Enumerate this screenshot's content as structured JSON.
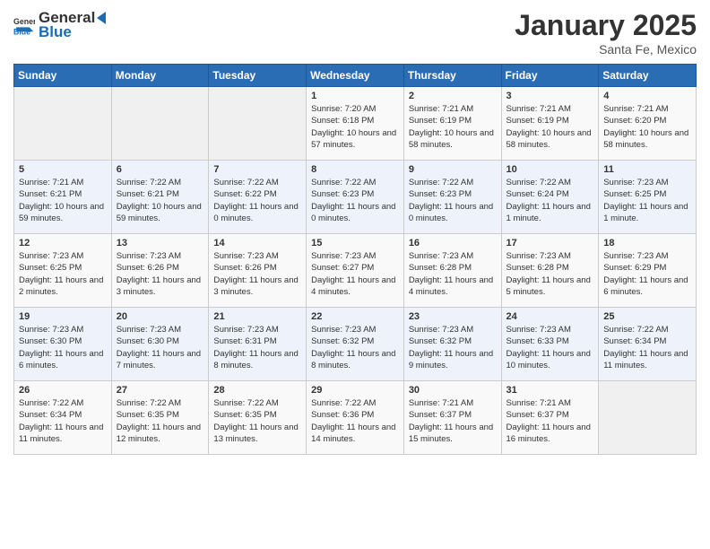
{
  "logo": {
    "general": "General",
    "blue": "Blue"
  },
  "header": {
    "month": "January 2025",
    "location": "Santa Fe, Mexico"
  },
  "weekdays": [
    "Sunday",
    "Monday",
    "Tuesday",
    "Wednesday",
    "Thursday",
    "Friday",
    "Saturday"
  ],
  "weeks": [
    [
      {
        "day": "",
        "sunrise": "",
        "sunset": "",
        "daylight": ""
      },
      {
        "day": "",
        "sunrise": "",
        "sunset": "",
        "daylight": ""
      },
      {
        "day": "",
        "sunrise": "",
        "sunset": "",
        "daylight": ""
      },
      {
        "day": "1",
        "sunrise": "Sunrise: 7:20 AM",
        "sunset": "Sunset: 6:18 PM",
        "daylight": "Daylight: 10 hours and 57 minutes."
      },
      {
        "day": "2",
        "sunrise": "Sunrise: 7:21 AM",
        "sunset": "Sunset: 6:19 PM",
        "daylight": "Daylight: 10 hours and 58 minutes."
      },
      {
        "day": "3",
        "sunrise": "Sunrise: 7:21 AM",
        "sunset": "Sunset: 6:19 PM",
        "daylight": "Daylight: 10 hours and 58 minutes."
      },
      {
        "day": "4",
        "sunrise": "Sunrise: 7:21 AM",
        "sunset": "Sunset: 6:20 PM",
        "daylight": "Daylight: 10 hours and 58 minutes."
      }
    ],
    [
      {
        "day": "5",
        "sunrise": "Sunrise: 7:21 AM",
        "sunset": "Sunset: 6:21 PM",
        "daylight": "Daylight: 10 hours and 59 minutes."
      },
      {
        "day": "6",
        "sunrise": "Sunrise: 7:22 AM",
        "sunset": "Sunset: 6:21 PM",
        "daylight": "Daylight: 10 hours and 59 minutes."
      },
      {
        "day": "7",
        "sunrise": "Sunrise: 7:22 AM",
        "sunset": "Sunset: 6:22 PM",
        "daylight": "Daylight: 11 hours and 0 minutes."
      },
      {
        "day": "8",
        "sunrise": "Sunrise: 7:22 AM",
        "sunset": "Sunset: 6:23 PM",
        "daylight": "Daylight: 11 hours and 0 minutes."
      },
      {
        "day": "9",
        "sunrise": "Sunrise: 7:22 AM",
        "sunset": "Sunset: 6:23 PM",
        "daylight": "Daylight: 11 hours and 0 minutes."
      },
      {
        "day": "10",
        "sunrise": "Sunrise: 7:22 AM",
        "sunset": "Sunset: 6:24 PM",
        "daylight": "Daylight: 11 hours and 1 minute."
      },
      {
        "day": "11",
        "sunrise": "Sunrise: 7:23 AM",
        "sunset": "Sunset: 6:25 PM",
        "daylight": "Daylight: 11 hours and 1 minute."
      }
    ],
    [
      {
        "day": "12",
        "sunrise": "Sunrise: 7:23 AM",
        "sunset": "Sunset: 6:25 PM",
        "daylight": "Daylight: 11 hours and 2 minutes."
      },
      {
        "day": "13",
        "sunrise": "Sunrise: 7:23 AM",
        "sunset": "Sunset: 6:26 PM",
        "daylight": "Daylight: 11 hours and 3 minutes."
      },
      {
        "day": "14",
        "sunrise": "Sunrise: 7:23 AM",
        "sunset": "Sunset: 6:26 PM",
        "daylight": "Daylight: 11 hours and 3 minutes."
      },
      {
        "day": "15",
        "sunrise": "Sunrise: 7:23 AM",
        "sunset": "Sunset: 6:27 PM",
        "daylight": "Daylight: 11 hours and 4 minutes."
      },
      {
        "day": "16",
        "sunrise": "Sunrise: 7:23 AM",
        "sunset": "Sunset: 6:28 PM",
        "daylight": "Daylight: 11 hours and 4 minutes."
      },
      {
        "day": "17",
        "sunrise": "Sunrise: 7:23 AM",
        "sunset": "Sunset: 6:28 PM",
        "daylight": "Daylight: 11 hours and 5 minutes."
      },
      {
        "day": "18",
        "sunrise": "Sunrise: 7:23 AM",
        "sunset": "Sunset: 6:29 PM",
        "daylight": "Daylight: 11 hours and 6 minutes."
      }
    ],
    [
      {
        "day": "19",
        "sunrise": "Sunrise: 7:23 AM",
        "sunset": "Sunset: 6:30 PM",
        "daylight": "Daylight: 11 hours and 6 minutes."
      },
      {
        "day": "20",
        "sunrise": "Sunrise: 7:23 AM",
        "sunset": "Sunset: 6:30 PM",
        "daylight": "Daylight: 11 hours and 7 minutes."
      },
      {
        "day": "21",
        "sunrise": "Sunrise: 7:23 AM",
        "sunset": "Sunset: 6:31 PM",
        "daylight": "Daylight: 11 hours and 8 minutes."
      },
      {
        "day": "22",
        "sunrise": "Sunrise: 7:23 AM",
        "sunset": "Sunset: 6:32 PM",
        "daylight": "Daylight: 11 hours and 8 minutes."
      },
      {
        "day": "23",
        "sunrise": "Sunrise: 7:23 AM",
        "sunset": "Sunset: 6:32 PM",
        "daylight": "Daylight: 11 hours and 9 minutes."
      },
      {
        "day": "24",
        "sunrise": "Sunrise: 7:23 AM",
        "sunset": "Sunset: 6:33 PM",
        "daylight": "Daylight: 11 hours and 10 minutes."
      },
      {
        "day": "25",
        "sunrise": "Sunrise: 7:22 AM",
        "sunset": "Sunset: 6:34 PM",
        "daylight": "Daylight: 11 hours and 11 minutes."
      }
    ],
    [
      {
        "day": "26",
        "sunrise": "Sunrise: 7:22 AM",
        "sunset": "Sunset: 6:34 PM",
        "daylight": "Daylight: 11 hours and 11 minutes."
      },
      {
        "day": "27",
        "sunrise": "Sunrise: 7:22 AM",
        "sunset": "Sunset: 6:35 PM",
        "daylight": "Daylight: 11 hours and 12 minutes."
      },
      {
        "day": "28",
        "sunrise": "Sunrise: 7:22 AM",
        "sunset": "Sunset: 6:35 PM",
        "daylight": "Daylight: 11 hours and 13 minutes."
      },
      {
        "day": "29",
        "sunrise": "Sunrise: 7:22 AM",
        "sunset": "Sunset: 6:36 PM",
        "daylight": "Daylight: 11 hours and 14 minutes."
      },
      {
        "day": "30",
        "sunrise": "Sunrise: 7:21 AM",
        "sunset": "Sunset: 6:37 PM",
        "daylight": "Daylight: 11 hours and 15 minutes."
      },
      {
        "day": "31",
        "sunrise": "Sunrise: 7:21 AM",
        "sunset": "Sunset: 6:37 PM",
        "daylight": "Daylight: 11 hours and 16 minutes."
      },
      {
        "day": "",
        "sunrise": "",
        "sunset": "",
        "daylight": ""
      }
    ]
  ]
}
